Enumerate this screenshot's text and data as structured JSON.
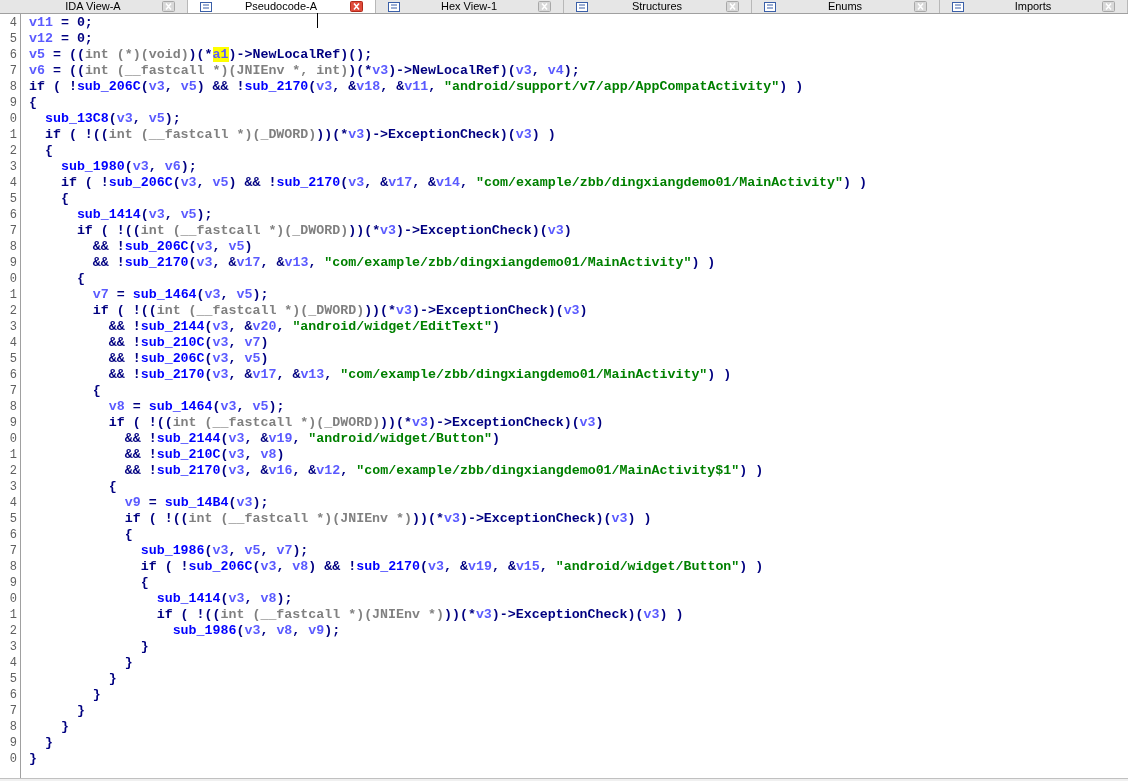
{
  "tabs": [
    {
      "label": "IDA View-A",
      "selected": false,
      "icon": false
    },
    {
      "label": "Pseudocode-A",
      "selected": true,
      "icon": true
    },
    {
      "label": "Hex View-1",
      "selected": false,
      "icon": true
    },
    {
      "label": "Structures",
      "selected": false,
      "icon": true
    },
    {
      "label": "Enums",
      "selected": false,
      "icon": true
    },
    {
      "label": "Imports",
      "selected": false,
      "icon": true
    }
  ],
  "code": {
    "lines": [
      {
        "number": "4",
        "tokens": [
          {
            "kind": "var",
            "text": "v11"
          },
          {
            "kind": "op",
            "text": " = 0;"
          }
        ]
      },
      {
        "number": "5",
        "tokens": [
          {
            "kind": "var",
            "text": "v12"
          },
          {
            "kind": "op",
            "text": " = 0;"
          }
        ]
      },
      {
        "number": "6",
        "tokens": [
          {
            "kind": "var",
            "text": "v5"
          },
          {
            "kind": "op",
            "text": " = (("
          },
          {
            "kind": "cast",
            "text": "int (*)(void)"
          },
          {
            "kind": "op",
            "text": ")(*"
          },
          {
            "kind": "hl",
            "text": "a1"
          },
          {
            "kind": "op",
            "text": ")->NewLocalRef)();"
          }
        ]
      },
      {
        "number": "7",
        "tokens": [
          {
            "kind": "var",
            "text": "v6"
          },
          {
            "kind": "op",
            "text": " = (("
          },
          {
            "kind": "cast",
            "text": "int (__fastcall *)(JNIEnv *, int)"
          },
          {
            "kind": "op",
            "text": ")(*"
          },
          {
            "kind": "var",
            "text": "v3"
          },
          {
            "kind": "op",
            "text": ")->NewLocalRef)("
          },
          {
            "kind": "var",
            "text": "v3"
          },
          {
            "kind": "op",
            "text": ", "
          },
          {
            "kind": "var",
            "text": "v4"
          },
          {
            "kind": "op",
            "text": ");"
          }
        ]
      },
      {
        "number": "8",
        "tokens": [
          {
            "kind": "op",
            "text": "if ( !"
          },
          {
            "kind": "fn",
            "text": "sub_206C"
          },
          {
            "kind": "op",
            "text": "("
          },
          {
            "kind": "var",
            "text": "v3"
          },
          {
            "kind": "op",
            "text": ", "
          },
          {
            "kind": "var",
            "text": "v5"
          },
          {
            "kind": "op",
            "text": ") && !"
          },
          {
            "kind": "fn",
            "text": "sub_2170"
          },
          {
            "kind": "op",
            "text": "("
          },
          {
            "kind": "var",
            "text": "v3"
          },
          {
            "kind": "op",
            "text": ", &"
          },
          {
            "kind": "var",
            "text": "v18"
          },
          {
            "kind": "op",
            "text": ", &"
          },
          {
            "kind": "var",
            "text": "v11"
          },
          {
            "kind": "op",
            "text": ", "
          },
          {
            "kind": "str",
            "text": "\"android/support/v7/app/AppCompatActivity\""
          },
          {
            "kind": "op",
            "text": ") )"
          }
        ]
      },
      {
        "number": "9",
        "tokens": [
          {
            "kind": "op",
            "text": "{"
          }
        ]
      },
      {
        "number": "0",
        "tokens": [
          {
            "kind": "fn",
            "text": "  sub_13C8"
          },
          {
            "kind": "op",
            "text": "("
          },
          {
            "kind": "var",
            "text": "v3"
          },
          {
            "kind": "op",
            "text": ", "
          },
          {
            "kind": "var",
            "text": "v5"
          },
          {
            "kind": "op",
            "text": ");"
          }
        ]
      },
      {
        "number": "1",
        "tokens": [
          {
            "kind": "op",
            "text": "  if ( !(("
          },
          {
            "kind": "cast",
            "text": "int (__fastcall *)(_DWORD)"
          },
          {
            "kind": "op",
            "text": "))(*"
          },
          {
            "kind": "var",
            "text": "v3"
          },
          {
            "kind": "op",
            "text": ")->ExceptionCheck)("
          },
          {
            "kind": "var",
            "text": "v3"
          },
          {
            "kind": "op",
            "text": ") )"
          }
        ]
      },
      {
        "number": "2",
        "tokens": [
          {
            "kind": "op",
            "text": "  {"
          }
        ]
      },
      {
        "number": "3",
        "tokens": [
          {
            "kind": "fn",
            "text": "    sub_1980"
          },
          {
            "kind": "op",
            "text": "("
          },
          {
            "kind": "var",
            "text": "v3"
          },
          {
            "kind": "op",
            "text": ", "
          },
          {
            "kind": "var",
            "text": "v6"
          },
          {
            "kind": "op",
            "text": ");"
          }
        ]
      },
      {
        "number": "4",
        "tokens": [
          {
            "kind": "op",
            "text": "    if ( !"
          },
          {
            "kind": "fn",
            "text": "sub_206C"
          },
          {
            "kind": "op",
            "text": "("
          },
          {
            "kind": "var",
            "text": "v3"
          },
          {
            "kind": "op",
            "text": ", "
          },
          {
            "kind": "var",
            "text": "v5"
          },
          {
            "kind": "op",
            "text": ") && !"
          },
          {
            "kind": "fn",
            "text": "sub_2170"
          },
          {
            "kind": "op",
            "text": "("
          },
          {
            "kind": "var",
            "text": "v3"
          },
          {
            "kind": "op",
            "text": ", &"
          },
          {
            "kind": "var",
            "text": "v17"
          },
          {
            "kind": "op",
            "text": ", &"
          },
          {
            "kind": "var",
            "text": "v14"
          },
          {
            "kind": "op",
            "text": ", "
          },
          {
            "kind": "str",
            "text": "\"com/example/zbb/dingxiangdemo01/MainActivity\""
          },
          {
            "kind": "op",
            "text": ") )"
          }
        ]
      },
      {
        "number": "5",
        "tokens": [
          {
            "kind": "op",
            "text": "    {"
          }
        ]
      },
      {
        "number": "6",
        "tokens": [
          {
            "kind": "fn",
            "text": "      sub_1414"
          },
          {
            "kind": "op",
            "text": "("
          },
          {
            "kind": "var",
            "text": "v3"
          },
          {
            "kind": "op",
            "text": ", "
          },
          {
            "kind": "var",
            "text": "v5"
          },
          {
            "kind": "op",
            "text": ");"
          }
        ]
      },
      {
        "number": "7",
        "tokens": [
          {
            "kind": "op",
            "text": "      if ( !(("
          },
          {
            "kind": "cast",
            "text": "int (__fastcall *)(_DWORD)"
          },
          {
            "kind": "op",
            "text": "))(*"
          },
          {
            "kind": "var",
            "text": "v3"
          },
          {
            "kind": "op",
            "text": ")->ExceptionCheck)("
          },
          {
            "kind": "var",
            "text": "v3"
          },
          {
            "kind": "op",
            "text": ")"
          }
        ]
      },
      {
        "number": "8",
        "tokens": [
          {
            "kind": "op",
            "text": "        && !"
          },
          {
            "kind": "fn",
            "text": "sub_206C"
          },
          {
            "kind": "op",
            "text": "("
          },
          {
            "kind": "var",
            "text": "v3"
          },
          {
            "kind": "op",
            "text": ", "
          },
          {
            "kind": "var",
            "text": "v5"
          },
          {
            "kind": "op",
            "text": ")"
          }
        ]
      },
      {
        "number": "9",
        "tokens": [
          {
            "kind": "op",
            "text": "        && !"
          },
          {
            "kind": "fn",
            "text": "sub_2170"
          },
          {
            "kind": "op",
            "text": "("
          },
          {
            "kind": "var",
            "text": "v3"
          },
          {
            "kind": "op",
            "text": ", &"
          },
          {
            "kind": "var",
            "text": "v17"
          },
          {
            "kind": "op",
            "text": ", &"
          },
          {
            "kind": "var",
            "text": "v13"
          },
          {
            "kind": "op",
            "text": ", "
          },
          {
            "kind": "str",
            "text": "\"com/example/zbb/dingxiangdemo01/MainActivity\""
          },
          {
            "kind": "op",
            "text": ") )"
          }
        ]
      },
      {
        "number": "0",
        "tokens": [
          {
            "kind": "op",
            "text": "      {"
          }
        ]
      },
      {
        "number": "1",
        "tokens": [
          {
            "kind": "var",
            "text": "        v7"
          },
          {
            "kind": "op",
            "text": " = "
          },
          {
            "kind": "fn",
            "text": "sub_1464"
          },
          {
            "kind": "op",
            "text": "("
          },
          {
            "kind": "var",
            "text": "v3"
          },
          {
            "kind": "op",
            "text": ", "
          },
          {
            "kind": "var",
            "text": "v5"
          },
          {
            "kind": "op",
            "text": ");"
          }
        ]
      },
      {
        "number": "2",
        "tokens": [
          {
            "kind": "op",
            "text": "        if ( !(("
          },
          {
            "kind": "cast",
            "text": "int (__fastcall *)(_DWORD)"
          },
          {
            "kind": "op",
            "text": "))(*"
          },
          {
            "kind": "var",
            "text": "v3"
          },
          {
            "kind": "op",
            "text": ")->ExceptionCheck)("
          },
          {
            "kind": "var",
            "text": "v3"
          },
          {
            "kind": "op",
            "text": ")"
          }
        ]
      },
      {
        "number": "3",
        "tokens": [
          {
            "kind": "op",
            "text": "          && !"
          },
          {
            "kind": "fn",
            "text": "sub_2144"
          },
          {
            "kind": "op",
            "text": "("
          },
          {
            "kind": "var",
            "text": "v3"
          },
          {
            "kind": "op",
            "text": ", &"
          },
          {
            "kind": "var",
            "text": "v20"
          },
          {
            "kind": "op",
            "text": ", "
          },
          {
            "kind": "str",
            "text": "\"android/widget/EditText\""
          },
          {
            "kind": "op",
            "text": ")"
          }
        ]
      },
      {
        "number": "4",
        "tokens": [
          {
            "kind": "op",
            "text": "          && !"
          },
          {
            "kind": "fn",
            "text": "sub_210C"
          },
          {
            "kind": "op",
            "text": "("
          },
          {
            "kind": "var",
            "text": "v3"
          },
          {
            "kind": "op",
            "text": ", "
          },
          {
            "kind": "var",
            "text": "v7"
          },
          {
            "kind": "op",
            "text": ")"
          }
        ]
      },
      {
        "number": "5",
        "tokens": [
          {
            "kind": "op",
            "text": "          && !"
          },
          {
            "kind": "fn",
            "text": "sub_206C"
          },
          {
            "kind": "op",
            "text": "("
          },
          {
            "kind": "var",
            "text": "v3"
          },
          {
            "kind": "op",
            "text": ", "
          },
          {
            "kind": "var",
            "text": "v5"
          },
          {
            "kind": "op",
            "text": ")"
          }
        ]
      },
      {
        "number": "6",
        "tokens": [
          {
            "kind": "op",
            "text": "          && !"
          },
          {
            "kind": "fn",
            "text": "sub_2170"
          },
          {
            "kind": "op",
            "text": "("
          },
          {
            "kind": "var",
            "text": "v3"
          },
          {
            "kind": "op",
            "text": ", &"
          },
          {
            "kind": "var",
            "text": "v17"
          },
          {
            "kind": "op",
            "text": ", &"
          },
          {
            "kind": "var",
            "text": "v13"
          },
          {
            "kind": "op",
            "text": ", "
          },
          {
            "kind": "str",
            "text": "\"com/example/zbb/dingxiangdemo01/MainActivity\""
          },
          {
            "kind": "op",
            "text": ") )"
          }
        ]
      },
      {
        "number": "7",
        "tokens": [
          {
            "kind": "op",
            "text": "        {"
          }
        ]
      },
      {
        "number": "8",
        "tokens": [
          {
            "kind": "var",
            "text": "          v8"
          },
          {
            "kind": "op",
            "text": " = "
          },
          {
            "kind": "fn",
            "text": "sub_1464"
          },
          {
            "kind": "op",
            "text": "("
          },
          {
            "kind": "var",
            "text": "v3"
          },
          {
            "kind": "op",
            "text": ", "
          },
          {
            "kind": "var",
            "text": "v5"
          },
          {
            "kind": "op",
            "text": ");"
          }
        ]
      },
      {
        "number": "9",
        "tokens": [
          {
            "kind": "op",
            "text": "          if ( !(("
          },
          {
            "kind": "cast",
            "text": "int (__fastcall *)(_DWORD)"
          },
          {
            "kind": "op",
            "text": "))(*"
          },
          {
            "kind": "var",
            "text": "v3"
          },
          {
            "kind": "op",
            "text": ")->ExceptionCheck)("
          },
          {
            "kind": "var",
            "text": "v3"
          },
          {
            "kind": "op",
            "text": ")"
          }
        ]
      },
      {
        "number": "0",
        "tokens": [
          {
            "kind": "op",
            "text": "            && !"
          },
          {
            "kind": "fn",
            "text": "sub_2144"
          },
          {
            "kind": "op",
            "text": "("
          },
          {
            "kind": "var",
            "text": "v3"
          },
          {
            "kind": "op",
            "text": ", &"
          },
          {
            "kind": "var",
            "text": "v19"
          },
          {
            "kind": "op",
            "text": ", "
          },
          {
            "kind": "str",
            "text": "\"android/widget/Button\""
          },
          {
            "kind": "op",
            "text": ")"
          }
        ]
      },
      {
        "number": "1",
        "tokens": [
          {
            "kind": "op",
            "text": "            && !"
          },
          {
            "kind": "fn",
            "text": "sub_210C"
          },
          {
            "kind": "op",
            "text": "("
          },
          {
            "kind": "var",
            "text": "v3"
          },
          {
            "kind": "op",
            "text": ", "
          },
          {
            "kind": "var",
            "text": "v8"
          },
          {
            "kind": "op",
            "text": ")"
          }
        ]
      },
      {
        "number": "2",
        "tokens": [
          {
            "kind": "op",
            "text": "            && !"
          },
          {
            "kind": "fn",
            "text": "sub_2170"
          },
          {
            "kind": "op",
            "text": "("
          },
          {
            "kind": "var",
            "text": "v3"
          },
          {
            "kind": "op",
            "text": ", &"
          },
          {
            "kind": "var",
            "text": "v16"
          },
          {
            "kind": "op",
            "text": ", &"
          },
          {
            "kind": "var",
            "text": "v12"
          },
          {
            "kind": "op",
            "text": ", "
          },
          {
            "kind": "str",
            "text": "\"com/example/zbb/dingxiangdemo01/MainActivity$1\""
          },
          {
            "kind": "op",
            "text": ") )"
          }
        ]
      },
      {
        "number": "3",
        "tokens": [
          {
            "kind": "op",
            "text": "          {"
          }
        ]
      },
      {
        "number": "4",
        "tokens": [
          {
            "kind": "var",
            "text": "            v9"
          },
          {
            "kind": "op",
            "text": " = "
          },
          {
            "kind": "fn",
            "text": "sub_14B4"
          },
          {
            "kind": "op",
            "text": "("
          },
          {
            "kind": "var",
            "text": "v3"
          },
          {
            "kind": "op",
            "text": ");"
          }
        ]
      },
      {
        "number": "5",
        "tokens": [
          {
            "kind": "op",
            "text": "            if ( !(("
          },
          {
            "kind": "cast",
            "text": "int (__fastcall *)(JNIEnv *)"
          },
          {
            "kind": "op",
            "text": "))(*"
          },
          {
            "kind": "var",
            "text": "v3"
          },
          {
            "kind": "op",
            "text": ")->ExceptionCheck)("
          },
          {
            "kind": "var",
            "text": "v3"
          },
          {
            "kind": "op",
            "text": ") )"
          }
        ]
      },
      {
        "number": "6",
        "tokens": [
          {
            "kind": "op",
            "text": "            {"
          }
        ]
      },
      {
        "number": "7",
        "tokens": [
          {
            "kind": "fn",
            "text": "              sub_1986"
          },
          {
            "kind": "op",
            "text": "("
          },
          {
            "kind": "var",
            "text": "v3"
          },
          {
            "kind": "op",
            "text": ", "
          },
          {
            "kind": "var",
            "text": "v5"
          },
          {
            "kind": "op",
            "text": ", "
          },
          {
            "kind": "var",
            "text": "v7"
          },
          {
            "kind": "op",
            "text": ");"
          }
        ]
      },
      {
        "number": "8",
        "tokens": [
          {
            "kind": "op",
            "text": "              if ( !"
          },
          {
            "kind": "fn",
            "text": "sub_206C"
          },
          {
            "kind": "op",
            "text": "("
          },
          {
            "kind": "var",
            "text": "v3"
          },
          {
            "kind": "op",
            "text": ", "
          },
          {
            "kind": "var",
            "text": "v8"
          },
          {
            "kind": "op",
            "text": ") && !"
          },
          {
            "kind": "fn",
            "text": "sub_2170"
          },
          {
            "kind": "op",
            "text": "("
          },
          {
            "kind": "var",
            "text": "v3"
          },
          {
            "kind": "op",
            "text": ", &"
          },
          {
            "kind": "var",
            "text": "v19"
          },
          {
            "kind": "op",
            "text": ", &"
          },
          {
            "kind": "var",
            "text": "v15"
          },
          {
            "kind": "op",
            "text": ", "
          },
          {
            "kind": "str",
            "text": "\"android/widget/Button\""
          },
          {
            "kind": "op",
            "text": ") )"
          }
        ]
      },
      {
        "number": "9",
        "tokens": [
          {
            "kind": "op",
            "text": "              {"
          }
        ]
      },
      {
        "number": "0",
        "tokens": [
          {
            "kind": "fn",
            "text": "                sub_1414"
          },
          {
            "kind": "op",
            "text": "("
          },
          {
            "kind": "var",
            "text": "v3"
          },
          {
            "kind": "op",
            "text": ", "
          },
          {
            "kind": "var",
            "text": "v8"
          },
          {
            "kind": "op",
            "text": ");"
          }
        ]
      },
      {
        "number": "1",
        "tokens": [
          {
            "kind": "op",
            "text": "                if ( !(("
          },
          {
            "kind": "cast",
            "text": "int (__fastcall *)(JNIEnv *)"
          },
          {
            "kind": "op",
            "text": "))(*"
          },
          {
            "kind": "var",
            "text": "v3"
          },
          {
            "kind": "op",
            "text": ")->ExceptionCheck)("
          },
          {
            "kind": "var",
            "text": "v3"
          },
          {
            "kind": "op",
            "text": ") )"
          }
        ]
      },
      {
        "number": "2",
        "tokens": [
          {
            "kind": "fn",
            "text": "                  sub_1986"
          },
          {
            "kind": "op",
            "text": "("
          },
          {
            "kind": "var",
            "text": "v3"
          },
          {
            "kind": "op",
            "text": ", "
          },
          {
            "kind": "var",
            "text": "v8"
          },
          {
            "kind": "op",
            "text": ", "
          },
          {
            "kind": "var",
            "text": "v9"
          },
          {
            "kind": "op",
            "text": ");"
          }
        ]
      },
      {
        "number": "3",
        "tokens": [
          {
            "kind": "op",
            "text": "              }"
          }
        ]
      },
      {
        "number": "4",
        "tokens": [
          {
            "kind": "op",
            "text": "            }"
          }
        ]
      },
      {
        "number": "5",
        "tokens": [
          {
            "kind": "op",
            "text": "          }"
          }
        ]
      },
      {
        "number": "6",
        "tokens": [
          {
            "kind": "op",
            "text": "        }"
          }
        ]
      },
      {
        "number": "7",
        "tokens": [
          {
            "kind": "op",
            "text": "      }"
          }
        ]
      },
      {
        "number": "8",
        "tokens": [
          {
            "kind": "op",
            "text": "    }"
          }
        ]
      },
      {
        "number": "9",
        "tokens": [
          {
            "kind": "op",
            "text": "  }"
          }
        ]
      },
      {
        "number": "0",
        "tokens": [
          {
            "kind": "op",
            "text": "}"
          }
        ]
      }
    ]
  }
}
